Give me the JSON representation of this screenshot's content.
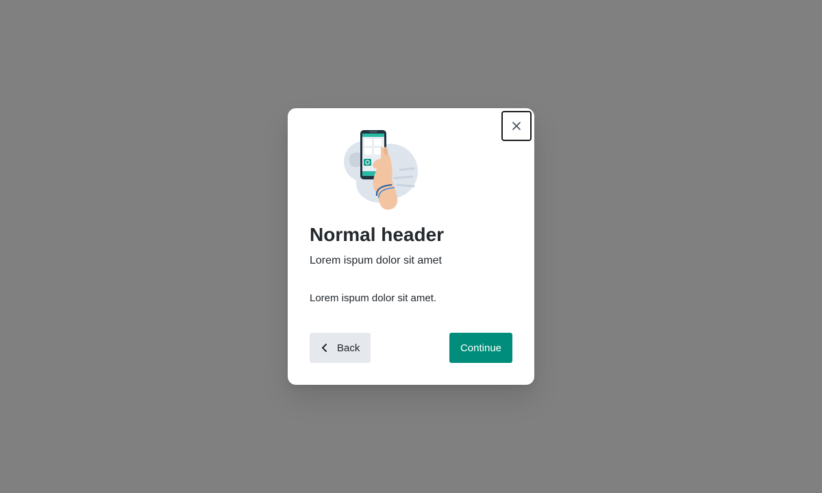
{
  "modal": {
    "title": "Normal header",
    "subtitle": "Lorem ispum dolor sit amet",
    "body": "Lorem ispum dolor sit amet.",
    "illustration": "hand-holding-phone-illustration"
  },
  "actions": {
    "close_icon": "close-icon",
    "back_label": "Back",
    "back_icon": "chevron-left-icon",
    "continue_label": "Continue"
  },
  "colors": {
    "overlay": "#808080",
    "primary": "#008d7b",
    "secondary_button": "#e5e9ed",
    "text": "#23282d"
  }
}
